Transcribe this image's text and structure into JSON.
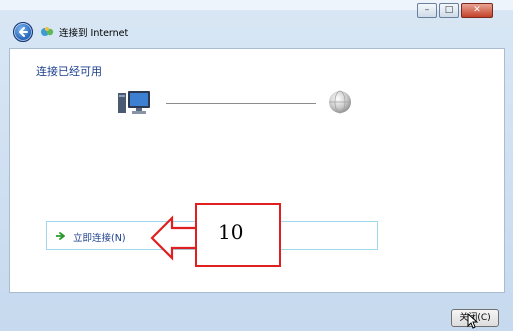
{
  "window": {
    "title": "连接到 Internet",
    "controls": {
      "minimize": "–",
      "maximize": "□",
      "close": "✕"
    }
  },
  "main": {
    "heading": "连接已经可用",
    "connect_option_label": "立即连接(N)"
  },
  "annotation": {
    "number": "10",
    "color": "#e02020"
  },
  "footer": {
    "close_button_label": "关闭(C)"
  },
  "icons": {
    "back": "back-arrow-icon",
    "network": "network-icon",
    "computer": "computer-icon",
    "globe": "globe-icon",
    "option_arrow": "green-arrow-icon",
    "cursor": "mouse-cursor-icon"
  },
  "colors": {
    "accent_text": "#1b3f8c",
    "option_border": "#9fd8ec",
    "option_arrow": "#2a9a2a"
  }
}
